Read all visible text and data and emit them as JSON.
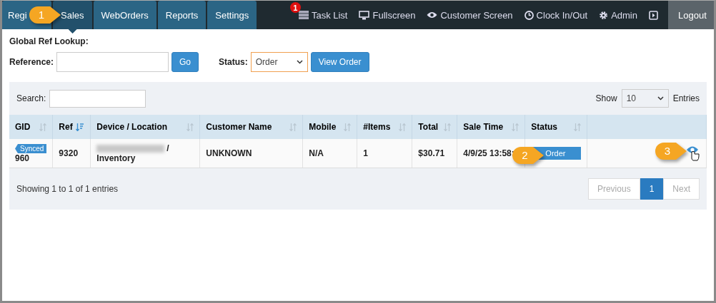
{
  "nav": {
    "tabs": [
      {
        "label": "Regi",
        "selected": false
      },
      {
        "label": "Sales",
        "selected": true
      },
      {
        "label": "WebOrders",
        "selected": false
      },
      {
        "label": "Reports",
        "selected": false
      },
      {
        "label": "Settings",
        "selected": false
      }
    ],
    "task_badge": "1",
    "links": [
      {
        "kind": "tasks",
        "label": "Task List"
      },
      {
        "kind": "fullscreen",
        "label": "Fullscreen"
      },
      {
        "kind": "customer",
        "label": "Customer Screen"
      },
      {
        "kind": "clock",
        "label": "Clock In/Out"
      },
      {
        "kind": "admin",
        "label": "Admin"
      },
      {
        "kind": "exit"
      }
    ],
    "logout": "Logout"
  },
  "lookup": {
    "title": "Global Ref Lookup:",
    "reference_label": "Reference:",
    "go_button": "Go",
    "status_label": "Status:",
    "status_value": "Order",
    "view_button": "View Order"
  },
  "table": {
    "search_label": "Search:",
    "show_label": "Show",
    "page_size": "10",
    "entries_label": "Entries",
    "columns": [
      {
        "label": "GID",
        "sorted": false
      },
      {
        "label": "Ref",
        "sorted": true
      },
      {
        "label": "Device / Location",
        "sorted": false
      },
      {
        "label": "Customer Name",
        "sorted": false
      },
      {
        "label": "Mobile",
        "sorted": false
      },
      {
        "label": "#Items",
        "sorted": false
      },
      {
        "label": "Total",
        "sorted": false
      },
      {
        "label": "Sale Time",
        "sorted": false
      },
      {
        "label": "Status",
        "sorted": false
      }
    ],
    "rows": [
      {
        "gid_badge": "Synced",
        "gid": "960",
        "ref": "9320",
        "device_redacted": true,
        "device_tail": "/",
        "location": "Inventory",
        "customer": "UNKNOWN",
        "mobile": "N/A",
        "items": "1",
        "total": "$30.71",
        "sale_time": "4/9/25 13:58:",
        "status": "Order"
      }
    ],
    "info": "Showing 1 to 1 of 1 entries",
    "pagination": [
      {
        "label": "Previous",
        "selected": false,
        "disabled": true
      },
      {
        "label": "1",
        "selected": true,
        "disabled": false
      },
      {
        "label": "Next",
        "selected": false,
        "disabled": true
      }
    ]
  },
  "callouts": [
    {
      "number": "1"
    },
    {
      "number": "2"
    },
    {
      "number": "3"
    }
  ]
}
